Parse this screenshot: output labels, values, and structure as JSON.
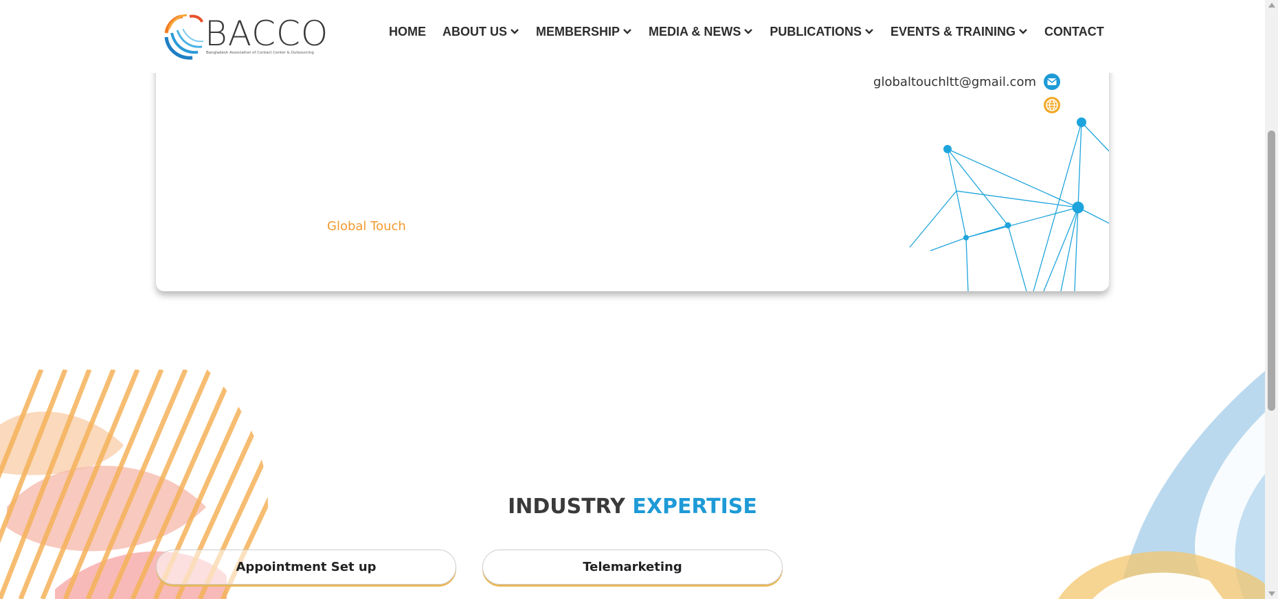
{
  "brand": {
    "name": "BACCO",
    "tagline": "Bangladesh Association of Contact Center & Outsourcing"
  },
  "nav": {
    "items": [
      {
        "label": "HOME",
        "dropdown": false
      },
      {
        "label": "ABOUT US",
        "dropdown": true
      },
      {
        "label": "MEMBERSHIP",
        "dropdown": true
      },
      {
        "label": "MEDIA & NEWS",
        "dropdown": true
      },
      {
        "label": "PUBLICATIONS",
        "dropdown": true
      },
      {
        "label": "EVENTS & TRAINING",
        "dropdown": true
      },
      {
        "label": "CONTACT",
        "dropdown": false
      }
    ]
  },
  "profile": {
    "email": "globaltouchltt@gmail.com",
    "email_icon": "mail-icon",
    "website_icon": "globe-icon",
    "company_name": "Global Touch"
  },
  "expertise": {
    "title_part1": "INDUSTRY",
    "title_part2": "EXPERTISE",
    "items": [
      "Appointment Set up",
      "Telemarketing"
    ]
  },
  "colors": {
    "accent_blue": "#1e9ad6",
    "accent_orange": "#f39a2e",
    "text_dark": "#2d2d2d"
  }
}
